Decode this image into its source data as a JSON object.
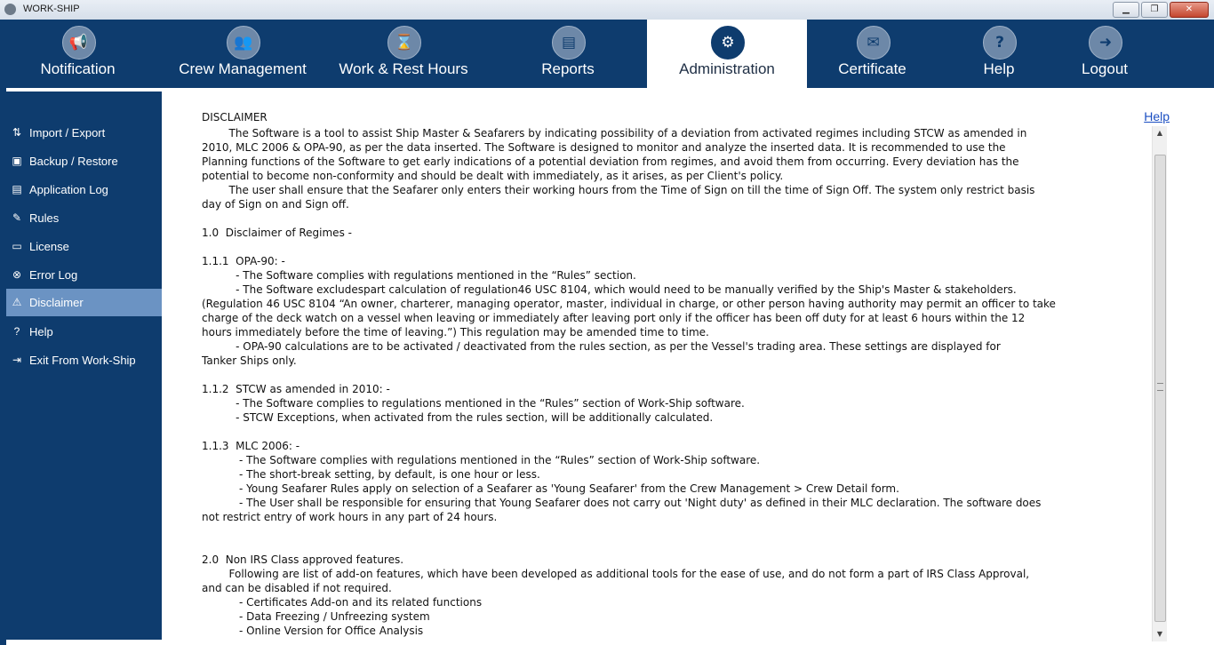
{
  "window": {
    "title": "WORK-SHIP",
    "buttons": [
      "▁",
      "❐",
      "✕"
    ]
  },
  "nav": {
    "tabs": [
      {
        "label": "Notification",
        "icon": "megaphone-icon",
        "glyph": "📢"
      },
      {
        "label": "Crew Management",
        "icon": "crew-icon",
        "glyph": "👥"
      },
      {
        "label": "Work & Rest Hours",
        "icon": "hourglass-icon",
        "glyph": "⌛"
      },
      {
        "label": "Reports",
        "icon": "reports-icon",
        "glyph": "▤"
      },
      {
        "label": "Administration",
        "icon": "admin-icon",
        "glyph": "⚙"
      },
      {
        "label": "Certificate",
        "icon": "certificate-icon",
        "glyph": "✉"
      },
      {
        "label": "Help",
        "icon": "help-icon",
        "glyph": "?"
      },
      {
        "label": "Logout",
        "icon": "logout-icon",
        "glyph": "➜"
      }
    ],
    "active": "Administration"
  },
  "sidebar": {
    "items": [
      {
        "label": "Import / Export",
        "icon": "import-export-icon",
        "glyph": "⇅"
      },
      {
        "label": "Backup / Restore",
        "icon": "backup-icon",
        "glyph": "▣"
      },
      {
        "label": "Application Log",
        "icon": "log-icon",
        "glyph": "▤"
      },
      {
        "label": "Rules",
        "icon": "rules-icon",
        "glyph": "✎"
      },
      {
        "label": "License",
        "icon": "license-icon",
        "glyph": "▭"
      },
      {
        "label": "Error Log",
        "icon": "error-icon",
        "glyph": "⊗"
      },
      {
        "label": "Disclaimer",
        "icon": "warning-icon",
        "glyph": "⚠"
      },
      {
        "label": "Help",
        "icon": "help-icon",
        "glyph": "?"
      },
      {
        "label": "Exit From Work-Ship",
        "icon": "exit-icon",
        "glyph": "⇥"
      }
    ],
    "active": "Disclaimer"
  },
  "content": {
    "help_link": "Help",
    "heading": "DISCLAIMER",
    "lines": [
      "        The Software is a tool to assist Ship Master & Seafarers by indicating possibility of a deviation from activated regimes including STCW as amended in",
      "2010, MLC 2006 & OPA-90, as per the data inserted. The Software is designed to monitor and analyze the inserted data. It is recommended to use the",
      "Planning functions of the Software to get early indications of a potential deviation from regimes, and avoid them from occurring. Every deviation has the",
      "potential to become non-conformity and should be dealt with immediately, as it arises, as per Client's policy.",
      "        The user shall ensure that the Seafarer only enters their working hours from the Time of Sign on till the time of Sign Off. The system only restrict basis",
      "day of Sign on and Sign off.",
      "",
      "1.0  Disclaimer of Regimes -",
      "",
      "1.1.1  OPA-90: -",
      "          - The Software complies with regulations mentioned in the “Rules” section.",
      "          - The Software excludespart calculation of regulation46 USC 8104, which would need to be manually verified by the Ship's Master & stakeholders.",
      "(Regulation 46 USC 8104 “An owner, charterer, managing operator, master, individual in charge, or other person having authority may permit an officer to take",
      "charge of the deck watch on a vessel when leaving or immediately after leaving port only if the officer has been off duty for at least 6 hours within the 12",
      "hours immediately before the time of leaving.”) This regulation may be amended time to time.",
      "          - OPA-90 calculations are to be activated / deactivated from the rules section, as per the Vessel's trading area. These settings are displayed for",
      "Tanker Ships only.",
      "",
      "1.1.2  STCW as amended in 2010: -",
      "          - The Software complies to regulations mentioned in the “Rules” section of Work-Ship software.",
      "          - STCW Exceptions, when activated from the rules section, will be additionally calculated.",
      "",
      "1.1.3  MLC 2006: -",
      "           - The Software complies with regulations mentioned in the “Rules” section of Work-Ship software.",
      "           - The short-break setting, by default, is one hour or less.",
      "           - Young Seafarer Rules apply on selection of a Seafarer as 'Young Seafarer' from the Crew Management > Crew Detail form.",
      "           - The User shall be responsible for ensuring that Young Seafarer does not carry out 'Night duty' as defined in their MLC declaration. The software does",
      "not restrict entry of work hours in any part of 24 hours.",
      "",
      "",
      "2.0  Non IRS Class approved features.",
      "        Following are list of add-on features, which have been developed as additional tools for the ease of use, and do not form a part of IRS Class Approval,",
      "and can be disabled if not required.",
      "           - Certificates Add-on and its related functions",
      "           - Data Freezing / Unfreezing system",
      "           - Online Version for Office Analysis"
    ]
  },
  "colors": {
    "nav_bg": "#0e3c6e",
    "sidebar_active": "#6b93c3",
    "link": "#1a4ec2"
  }
}
